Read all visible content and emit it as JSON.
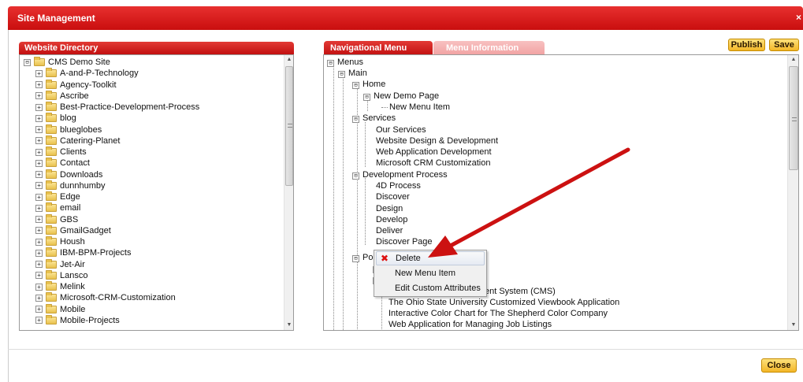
{
  "window": {
    "title": "Site Management",
    "close_glyph": "×",
    "close_icon": "close-icon"
  },
  "website_directory": {
    "header": "Website Directory",
    "root": "CMS Demo Site",
    "root_expander": "⊟",
    "folder_expander": "+",
    "items": [
      "A-and-P-Technology",
      "Agency-Toolkit",
      "Ascribe",
      "Best-Practice-Development-Process",
      "blog",
      "blueglobes",
      "Catering-Planet",
      "Clients",
      "Contact",
      "Downloads",
      "dunnhumby",
      "Edge",
      "email",
      "GBS",
      "GmailGadget",
      "Housh",
      "IBM-BPM-Projects",
      "Jet-Air",
      "Lansco",
      "Melink",
      "Microsoft-CRM-Customization",
      "Mobile",
      "Mobile-Projects"
    ],
    "scroll_up": "▲",
    "scroll_down": "▼"
  },
  "tabs": [
    {
      "label": "Navigational Menu",
      "active": true
    },
    {
      "label": "Menu Information",
      "active": false
    }
  ],
  "toolbar": {
    "publish_label": "Publish",
    "save_label": "Save"
  },
  "nav_menu": {
    "expander_minus": "⊟",
    "expander_plus": "⊞",
    "rows": [
      {
        "label": "Menus"
      },
      {
        "label": "Main"
      },
      {
        "label": "Home"
      },
      {
        "label": "New Demo Page"
      },
      {
        "label": "New Menu Item"
      },
      {
        "label": "Services"
      },
      {
        "label": "Our Services"
      },
      {
        "label": "Website Design & Development"
      },
      {
        "label": "Web Application Development"
      },
      {
        "label": "Microsoft CRM Customization"
      },
      {
        "label": "Development Process"
      },
      {
        "label": "4D Process"
      },
      {
        "label": "Discover"
      },
      {
        "label": "Design"
      },
      {
        "label": "Develop"
      },
      {
        "label": "Deliver"
      },
      {
        "label": "Discover Page"
      },
      {
        "label": "Po"
      },
      {
        "label": ""
      },
      {
        "label": ""
      },
      {
        "label": "ent System (CMS)"
      },
      {
        "label": "The Ohio State University Customized Viewbook Application"
      },
      {
        "label": "Interactive Color Chart for The Shepherd Color Company"
      },
      {
        "label": "Web Application for Managing Job Listings"
      }
    ]
  },
  "context_menu": {
    "items": [
      {
        "label": "Delete",
        "icon": "delete-x-icon",
        "glyph": "✖"
      },
      {
        "label": "New Menu Item"
      },
      {
        "label": "Edit Custom Attributes"
      }
    ]
  },
  "annotation": {
    "color": "#cc1111"
  },
  "footer": {
    "close_label": "Close"
  },
  "colors": {
    "accent_red": "#d21a1a",
    "button_gold": "#f3b628",
    "inactive_tab": "#f4a9a9"
  }
}
